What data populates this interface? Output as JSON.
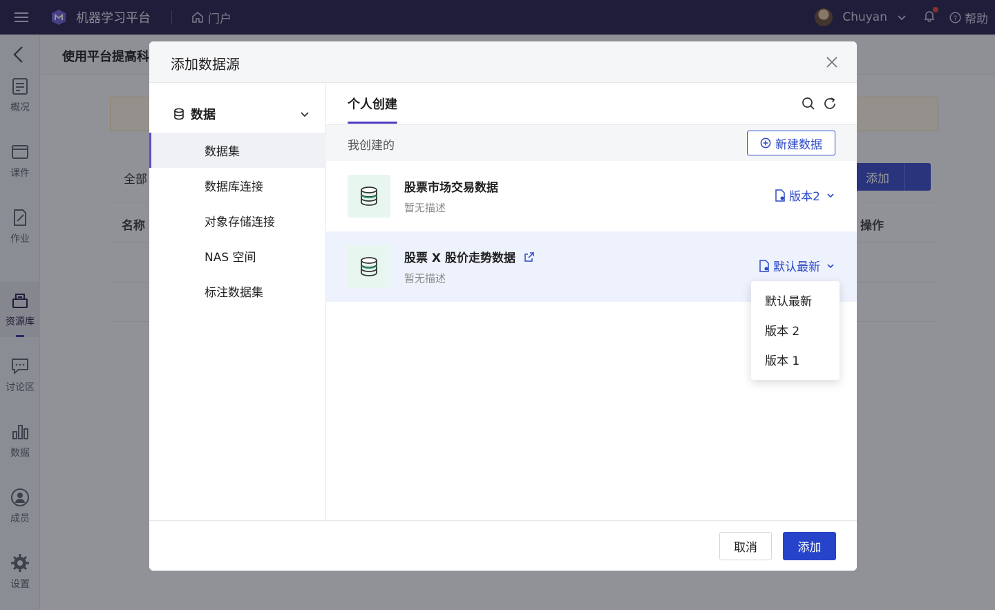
{
  "topbar": {
    "brand": "机器学习平台",
    "portal_label": "门户",
    "user_name": "Chuyan",
    "help_label": "帮助"
  },
  "sidebar": {
    "items": [
      {
        "label": "概况",
        "icon": "overview-icon"
      },
      {
        "label": "课件",
        "icon": "courseware-icon"
      },
      {
        "label": "作业",
        "icon": "assignment-icon"
      },
      {
        "label": "资源库",
        "icon": "resource-icon",
        "active": true
      },
      {
        "label": "讨论区",
        "icon": "discussion-icon"
      },
      {
        "label": "数据",
        "icon": "chart-icon"
      },
      {
        "label": "成员",
        "icon": "member-icon"
      },
      {
        "label": "设置",
        "icon": "gear-icon"
      }
    ]
  },
  "background": {
    "title": "使用平台提高科",
    "tab_all": "全部",
    "add_button": "添加",
    "col_name": "名称",
    "col_actions": "操作"
  },
  "modal": {
    "title": "添加数据源",
    "nav": {
      "group_label": "数据",
      "items": [
        {
          "label": "数据集",
          "active": true
        },
        {
          "label": "数据库连接"
        },
        {
          "label": "对象存储连接"
        },
        {
          "label": "NAS 空间"
        },
        {
          "label": "标注数据集"
        }
      ]
    },
    "tab_label": "个人创建",
    "subhead_label": "我创建的",
    "new_button": "新建数据",
    "datasets": [
      {
        "name": "股票市场交易数据",
        "desc": "暂无描述",
        "version": "版本2"
      },
      {
        "name": "股票 X 股价走势数据",
        "desc": "暂无描述",
        "version": "默认最新"
      }
    ],
    "version_dropdown": [
      "默认最新",
      "版本 2",
      "版本 1"
    ],
    "cancel_button": "取消",
    "add_button": "添加"
  },
  "colors": {
    "topbar": "#2a2350",
    "primary": "#2644c9",
    "accent_nav": "#5b4fc9",
    "dataset_icon_bg": "#e7f6ef",
    "dataset_icon": "#2f9c6b"
  }
}
